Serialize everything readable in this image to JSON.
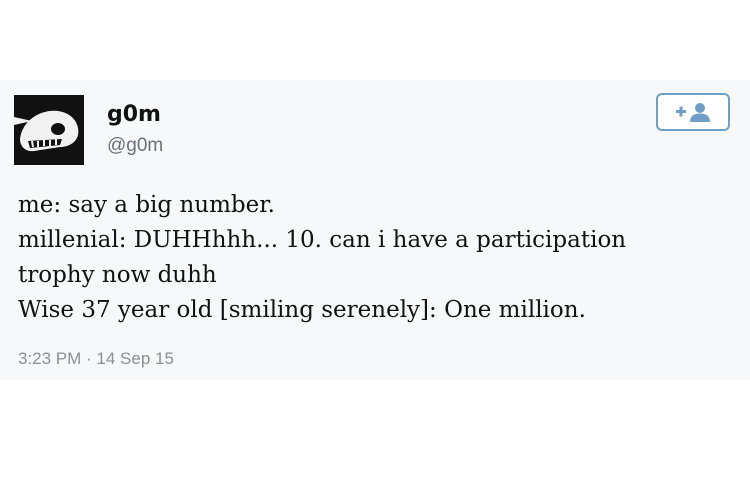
{
  "tweet": {
    "user": {
      "display_name": "g0m",
      "handle": "@g0m",
      "avatar_icon": "skull-avatar-icon"
    },
    "follow_button": {
      "icon": "add-user-icon"
    },
    "text_lines": [
      "me: say a big number.",
      "millenial: DUHHhhh... 10. can i have a participation",
      "trophy now duhh",
      "Wise 37 year old [smiling serenely]: One million."
    ],
    "timestamp": "3:23 PM · 14 Sep 15"
  },
  "colors": {
    "follow_accent": "#6f9fc7",
    "handle_gray": "#6b7077",
    "timestamp_gray": "#8a8f95"
  }
}
